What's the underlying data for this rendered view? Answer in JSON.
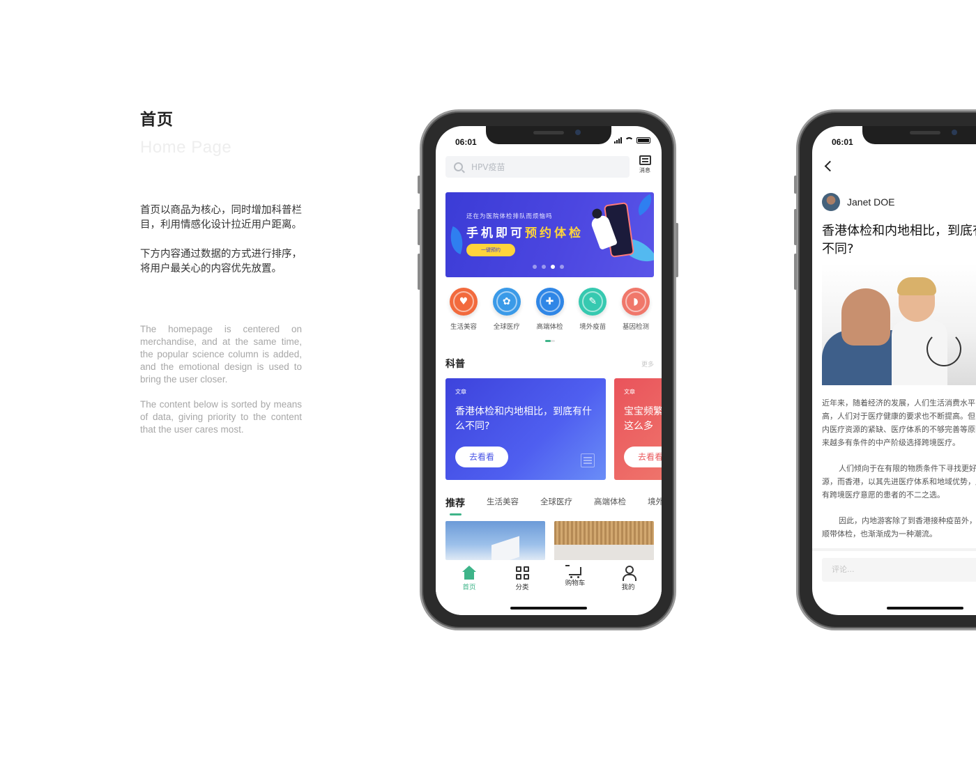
{
  "intro": {
    "title": "首页",
    "subtitle": "Home Page",
    "cn_paragraphs": [
      "首页以商品为核心，同时增加科普栏目，利用情感化设计拉近用户距离。",
      "下方内容通过数据的方式进行排序，将用户最关心的内容优先放置。"
    ],
    "en_paragraphs": [
      "The homepage is centered on merchandise, and at the same time, the popular science column is added, and the emotional design is used to bring the user closer.",
      "The content below is sorted by means of data, giving priority to the content that the user cares most."
    ]
  },
  "home": {
    "status_time": "06:01",
    "search_placeholder": "HPV疫苗",
    "message_label": "消息",
    "banner": {
      "subtitle": "还在为医院体检排队而烦恼吗",
      "title_part1": "手机即可",
      "title_highlight": "预约体检",
      "button": "一键预约",
      "dots_total": 4,
      "dots_active": 3
    },
    "categories": [
      {
        "label": "生活美容",
        "icon": "heart-icon",
        "color": "#f26a3d",
        "glyph": "♥"
      },
      {
        "label": "全球医疗",
        "icon": "gear-icon",
        "color": "#3a9ae8",
        "glyph": "✿"
      },
      {
        "label": "高端体检",
        "icon": "medical-kit-icon",
        "color": "#2f86e6",
        "glyph": "✚"
      },
      {
        "label": "境外疫苗",
        "icon": "syringe-icon",
        "color": "#36c9b0",
        "glyph": "✎"
      },
      {
        "label": "基因检测",
        "icon": "tooth-icon",
        "color": "#f0776a",
        "glyph": "◗"
      }
    ],
    "science": {
      "title": "科普",
      "more": "更多",
      "articles": [
        {
          "tag": "文章",
          "title": "香港体检和内地相比，到底有什么不同?",
          "button": "去看看"
        },
        {
          "tag": "文章",
          "title": "宝宝频繁这么多",
          "button": "去看看"
        }
      ]
    },
    "tabs": [
      "推荐",
      "生活美容",
      "全球医疗",
      "高端体检",
      "境外疫苗"
    ],
    "nav": [
      {
        "label": "首页",
        "icon": "home-icon",
        "active": true
      },
      {
        "label": "分类",
        "icon": "grid-icon",
        "active": false
      },
      {
        "label": "购物车",
        "icon": "cart-icon",
        "active": false
      },
      {
        "label": "我的",
        "icon": "user-icon",
        "active": false
      }
    ],
    "accent": "#3eb489"
  },
  "detail": {
    "status_time": "06:01",
    "author": "Janet DOE",
    "title_line1": "香港体检和内地相比，到底有什么",
    "title_line2": "不同?",
    "paragraphs": [
      [
        "近年来，随着经济的发展，人们生活消费水平日益提",
        "高，人们对于医疗健康的要求也不断提高。但由于国",
        "内医疗资源的紧缺、医疗体系的不够完善等原因，越",
        "来越多有条件的中产阶级选择跨境医疗。"
      ],
      [
        "人们倾向于在有限的物质条件下寻找更好的医疗资",
        "源，而香港，以其先进医疗体系和地域优势，成为了",
        "有跨境医疗意愿的患者的不二之选。"
      ],
      [
        "因此，内地游客除了到香港接种疫苗外，也开始",
        "顺带体检，也渐渐成为一种潮流。"
      ]
    ],
    "comment_placeholder": "评论..."
  }
}
